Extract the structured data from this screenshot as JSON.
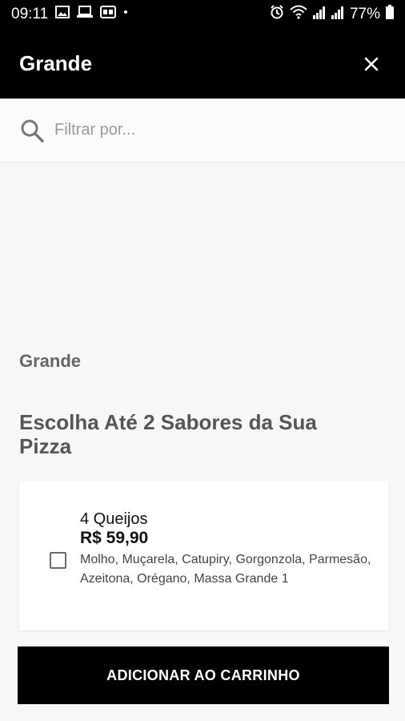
{
  "status_bar": {
    "time": "09:11",
    "notification_icons": [
      "image-icon",
      "laptop-icon",
      "badge-icon",
      "dot-icon"
    ],
    "battery": "77%",
    "system_icons": [
      "alarm-icon",
      "wifi-icon",
      "signal-icon",
      "signal-icon",
      "battery-icon"
    ]
  },
  "header": {
    "title": "Grande",
    "close_icon": "close-icon"
  },
  "search": {
    "placeholder": "Filtrar por...",
    "value": "",
    "icon": "search-icon"
  },
  "section_label": "Grande",
  "group_title": "Escolha Até 2 Sabores da Sua Pizza",
  "products": [
    {
      "name": "4 Queijos",
      "price": "R$ 59,90",
      "description": "Molho, Muçarela, Catupiry, Gorgonzola, Parmesão, Azeitona, Orégano, Massa Grande 1",
      "selected": false
    }
  ],
  "cart_button": {
    "label": "ADICIONAR AO CARRINHO"
  },
  "colors": {
    "header_bg": "#000000",
    "background": "#f7f7f7",
    "button_bg": "#000000"
  }
}
